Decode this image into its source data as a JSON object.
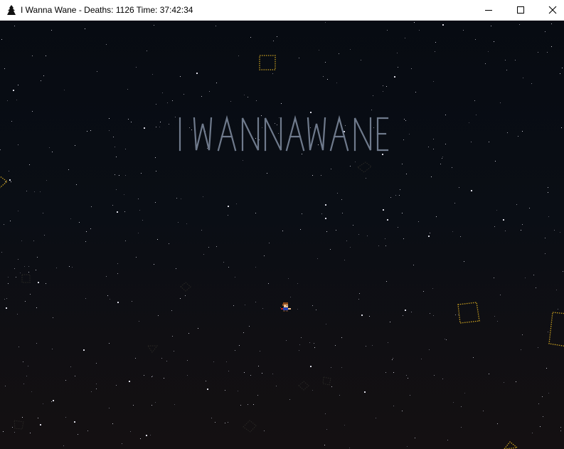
{
  "window": {
    "app_name": "I Wanna Wane",
    "separator": " - ",
    "deaths_label": "Deaths:",
    "deaths": "1126",
    "time_label": "Time:",
    "time": "37:42:34",
    "icons": {
      "app": "kid-silhouette-icon",
      "minimize": "minimize-icon",
      "maximize": "maximize-icon",
      "close": "close-icon"
    }
  },
  "game": {
    "title_logo": "I WANNA WANE",
    "colors": {
      "background_top": "#070b12",
      "background_bottom": "#141012",
      "logo": "#6f7a8c",
      "block_outline": "#c9a020",
      "player_hair": "#8a4a1c",
      "player_body": "#2040b0"
    }
  }
}
